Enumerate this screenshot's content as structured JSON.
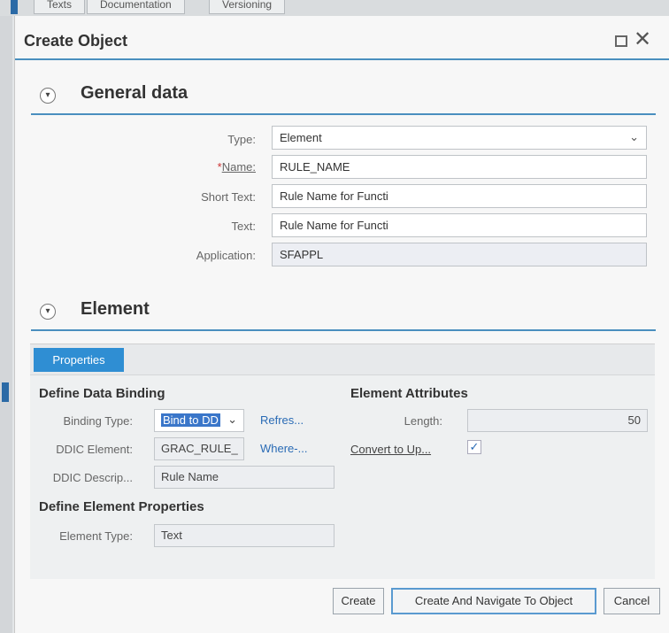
{
  "background": {
    "tabs": [
      "Texts",
      "Documentation",
      "Versioning"
    ]
  },
  "dialog": {
    "title": "Create Object"
  },
  "general_data": {
    "title": "General data",
    "type_label": "Type:",
    "type_value": "Element",
    "name_required": "*",
    "name_label": "Name:",
    "name_value": "RULE_NAME",
    "short_text_label": "Short Text:",
    "short_text_value": "Rule Name for Functi",
    "text_label": "Text:",
    "text_value": "Rule Name for Functi",
    "application_label": "Application:",
    "application_value": "SFAPPL"
  },
  "element": {
    "title": "Element",
    "tab_label": "Properties",
    "binding_group_title": "Define Data Binding",
    "binding_type_label": "Binding Type:",
    "binding_type_value": "Bind to DD",
    "refresh_link": "Refres...",
    "ddic_element_label": "DDIC Element:",
    "ddic_element_value": "GRAC_RULE_",
    "where_used_link": "Where-...",
    "ddic_desc_label": "DDIC Descrip...",
    "ddic_desc_value": "Rule Name",
    "elem_props_group_title": "Define Element Properties",
    "element_type_label": "Element Type:",
    "element_type_value": "Text",
    "attributes_group_title": "Element Attributes",
    "length_label": "Length:",
    "length_value": "50",
    "convert_upper_label": "Convert to Up...",
    "convert_upper_checked": "✓"
  },
  "buttons": {
    "create": "Create",
    "create_navigate": "Create And Navigate To Object",
    "cancel": "Cancel"
  }
}
